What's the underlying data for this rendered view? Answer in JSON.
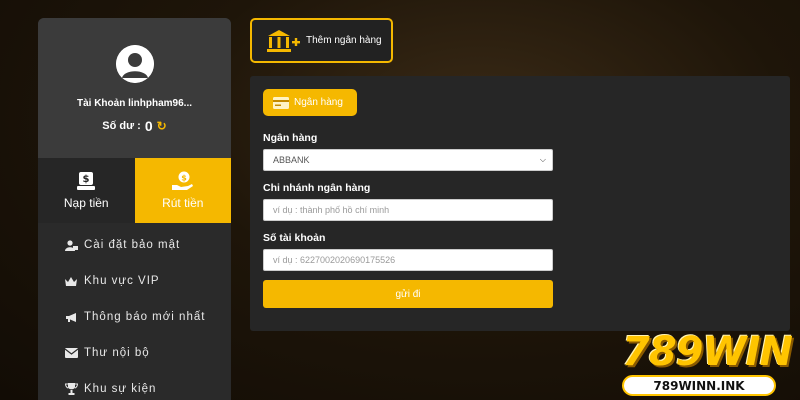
{
  "sidebar": {
    "account_label": "Tài Khoản linhpham96...",
    "balance_label": "Số dư :",
    "balance_value": "0",
    "actions": {
      "deposit": "Nạp tiền",
      "withdraw": "Rút tiền"
    },
    "menu": [
      {
        "label": "Cài đặt bảo mật",
        "icon": "user-lock-icon"
      },
      {
        "label": "Khu vực VIP",
        "icon": "crown-icon"
      },
      {
        "label": "Thông báo mới nhất",
        "icon": "megaphone-icon"
      },
      {
        "label": "Thư nội bộ",
        "icon": "envelope-icon"
      },
      {
        "label": "Khu sự kiện",
        "icon": "trophy-icon"
      }
    ]
  },
  "add_bank_label": "Thêm ngân hàng",
  "form": {
    "tab_label": "Ngân hàng",
    "bank_label": "Ngân hàng",
    "bank_value": "ABBANK",
    "branch_label": "Chi nhánh ngân hàng",
    "branch_placeholder": "ví dụ : thành phố hồ chí minh",
    "account_label": "Số tài khoản",
    "account_placeholder": "ví dụ : 6227002020690175526",
    "submit_label": "gửi đi"
  },
  "logo": {
    "brand": "789WIN",
    "url": "789WINN.INK"
  },
  "colors": {
    "accent": "#f5b800",
    "panel": "#262626",
    "sidebar": "#2a2a2a"
  }
}
